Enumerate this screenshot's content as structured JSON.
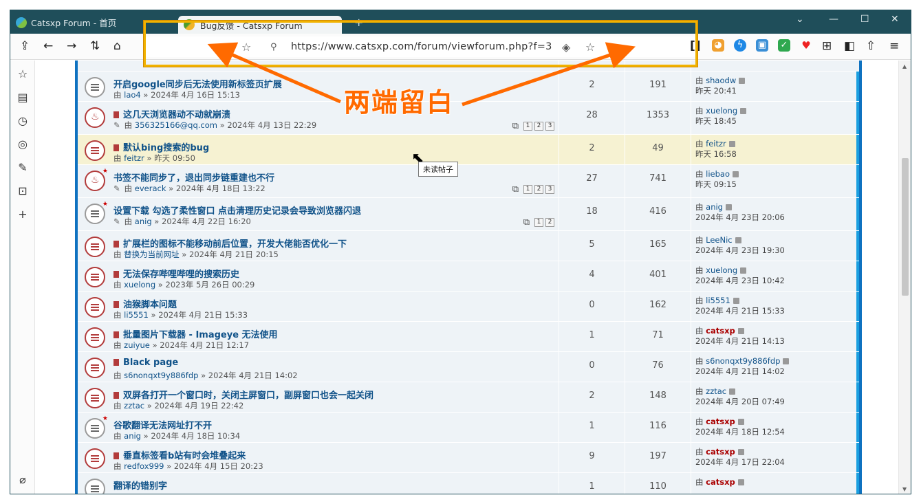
{
  "tabs": [
    {
      "title": "Catsxp Forum - 首页"
    },
    {
      "title": "Bug反馈 - Catsxp Forum"
    }
  ],
  "window_controls": [
    "chevron-down",
    "minimize",
    "maximize",
    "close"
  ],
  "url": "https://www.catsxp.com/forum/viewforum.php?f=3",
  "annotation": "两端留白",
  "tooltip": "未读帖子",
  "rows": [
    {
      "title": "开启google同步后无法使用新标签页扩展",
      "author": "lao4",
      "date": "2024年 4月 16日 15:13",
      "replies": "2",
      "views": "191",
      "last_user": "shaodw",
      "last_date": "昨天 20:41",
      "icon": "normal"
    },
    {
      "title": "这几天浏览器动不动就崩溃",
      "author": "356325166@qq.com",
      "date": "2024年 4月 13日 22:29",
      "replies": "28",
      "views": "1353",
      "last_user": "xuelong",
      "last_date": "昨天 18:45",
      "icon": "hot",
      "pages": [
        "1",
        "2",
        "3"
      ]
    },
    {
      "title": "默认bing搜索的bug",
      "author": "feitzr",
      "date": "昨天 09:50",
      "replies": "2",
      "views": "49",
      "last_user": "feitzr",
      "last_date": "昨天 16:58",
      "icon": "hot-lines"
    },
    {
      "title": "书签不能同步了，退出同步链重建也不行",
      "author": "everack",
      "date": "2024年 4月 18日 13:22",
      "replies": "27",
      "views": "741",
      "last_user": "liebao",
      "last_date": "昨天 09:15",
      "icon": "hot-star",
      "pages": [
        "1",
        "2",
        "3"
      ]
    },
    {
      "title": "设置下载 勾选了柔性窗口 点击清理历史记录会导致浏览器闪退",
      "author": "anig",
      "date": "2024年 4月 22日 16:20",
      "replies": "18",
      "views": "416",
      "last_user": "anig",
      "last_date": "2024年 4月 23日 20:06",
      "icon": "normal-star",
      "pages": [
        "1",
        "2"
      ]
    },
    {
      "title": "扩展栏的图标不能移动前后位置，开发大佬能否优化一下",
      "author": "替换为当前网址",
      "date": "2024年 4月 21日 20:15",
      "replies": "5",
      "views": "165",
      "last_user": "LeeNic",
      "last_date": "2024年 4月 23日 19:30",
      "icon": "hot-lines"
    },
    {
      "title": "无法保存哔哩哔哩的搜索历史",
      "author": "xuelong",
      "date": "2023年 5月 26日 00:29",
      "replies": "4",
      "views": "401",
      "last_user": "xuelong",
      "last_date": "2024年 4月 23日 10:42",
      "icon": "hot-lines"
    },
    {
      "title": "油猴脚本问题",
      "author": "li5551",
      "date": "2024年 4月 21日 15:33",
      "replies": "0",
      "views": "162",
      "last_user": "li5551",
      "last_date": "2024年 4月 21日 15:33",
      "icon": "hot-lines"
    },
    {
      "title": "批量图片下载器 - Imageye 无法使用",
      "author": "zuiyue",
      "date": "2024年 4月 21日 12:17",
      "replies": "1",
      "views": "71",
      "last_user": "catsxp",
      "last_date": "2024年 4月 21日 14:13",
      "icon": "hot-lines",
      "admin": true
    },
    {
      "title": "Black page",
      "author": "s6nonqxt9y886fdp",
      "date": "2024年 4月 21日 14:02",
      "replies": "0",
      "views": "76",
      "last_user": "s6nonqxt9y886fdp",
      "last_date": "2024年 4月 21日 14:02",
      "icon": "hot-lines"
    },
    {
      "title": "双屏各打开一个窗口时，关闭主屏窗口，副屏窗口也会一起关闭",
      "author": "zztac",
      "date": "2024年 4月 19日 22:42",
      "replies": "2",
      "views": "148",
      "last_user": "zztac",
      "last_date": "2024年 4月 20日 07:49",
      "icon": "hot-lines"
    },
    {
      "title": "谷歌翻译无法网址打不开",
      "author": "anig",
      "date": "2024年 4月 18日 10:34",
      "replies": "1",
      "views": "116",
      "last_user": "catsxp",
      "last_date": "2024年 4月 18日 12:54",
      "icon": "normal-star",
      "admin": true
    },
    {
      "title": "垂直标签看b站有时会堆叠起来",
      "author": "redfox999",
      "date": "2024年 4月 15日 20:23",
      "replies": "9",
      "views": "197",
      "last_user": "catsxp",
      "last_date": "2024年 4月 17日 22:04",
      "icon": "hot-lines",
      "admin": true
    },
    {
      "title": "翻译的错别字",
      "author": "",
      "date": "",
      "replies": "1",
      "views": "110",
      "last_user": "catsxp",
      "last_date": "",
      "icon": "normal",
      "admin": true
    }
  ],
  "colors": {
    "titlebar": "#1f4e5a",
    "link": "#105289",
    "admin": "#aa0000",
    "annotation": "#ff6a00",
    "annotation_box": "#f1b200",
    "row_bg": "#eef3f7",
    "row_hover": "#f6f2d2",
    "accent_border": "#1a9fe0"
  },
  "by_label": "由",
  "sep_label": "»"
}
